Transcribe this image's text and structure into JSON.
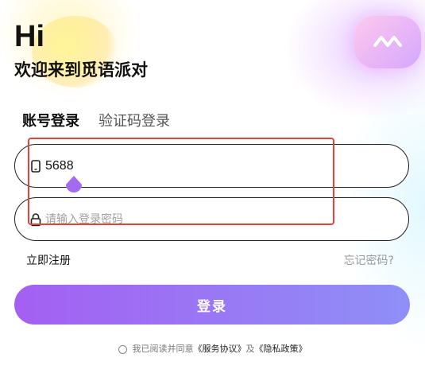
{
  "header": {
    "greeting": "Hi",
    "welcome": "欢迎来到觅语派对"
  },
  "tabs": [
    {
      "label": "账号登录",
      "active": true
    },
    {
      "label": "验证码登录",
      "active": false
    }
  ],
  "form": {
    "account": {
      "value": "5688",
      "icon": "phone-icon"
    },
    "password": {
      "value": "",
      "placeholder": "请输入登录密码",
      "icon": "lock-icon"
    }
  },
  "links": {
    "register": "立即注册",
    "forgot": "忘记密码?"
  },
  "login_button": "登录",
  "agreement": {
    "prefix": "我已阅读并同意",
    "service": "《服务协议》",
    "and": "及",
    "privacy": "《隐私政策》",
    "checked": false
  },
  "colors": {
    "accent_start": "#a45ff2",
    "accent_end": "#8f8ff7",
    "highlight_border": "#e0443a"
  }
}
